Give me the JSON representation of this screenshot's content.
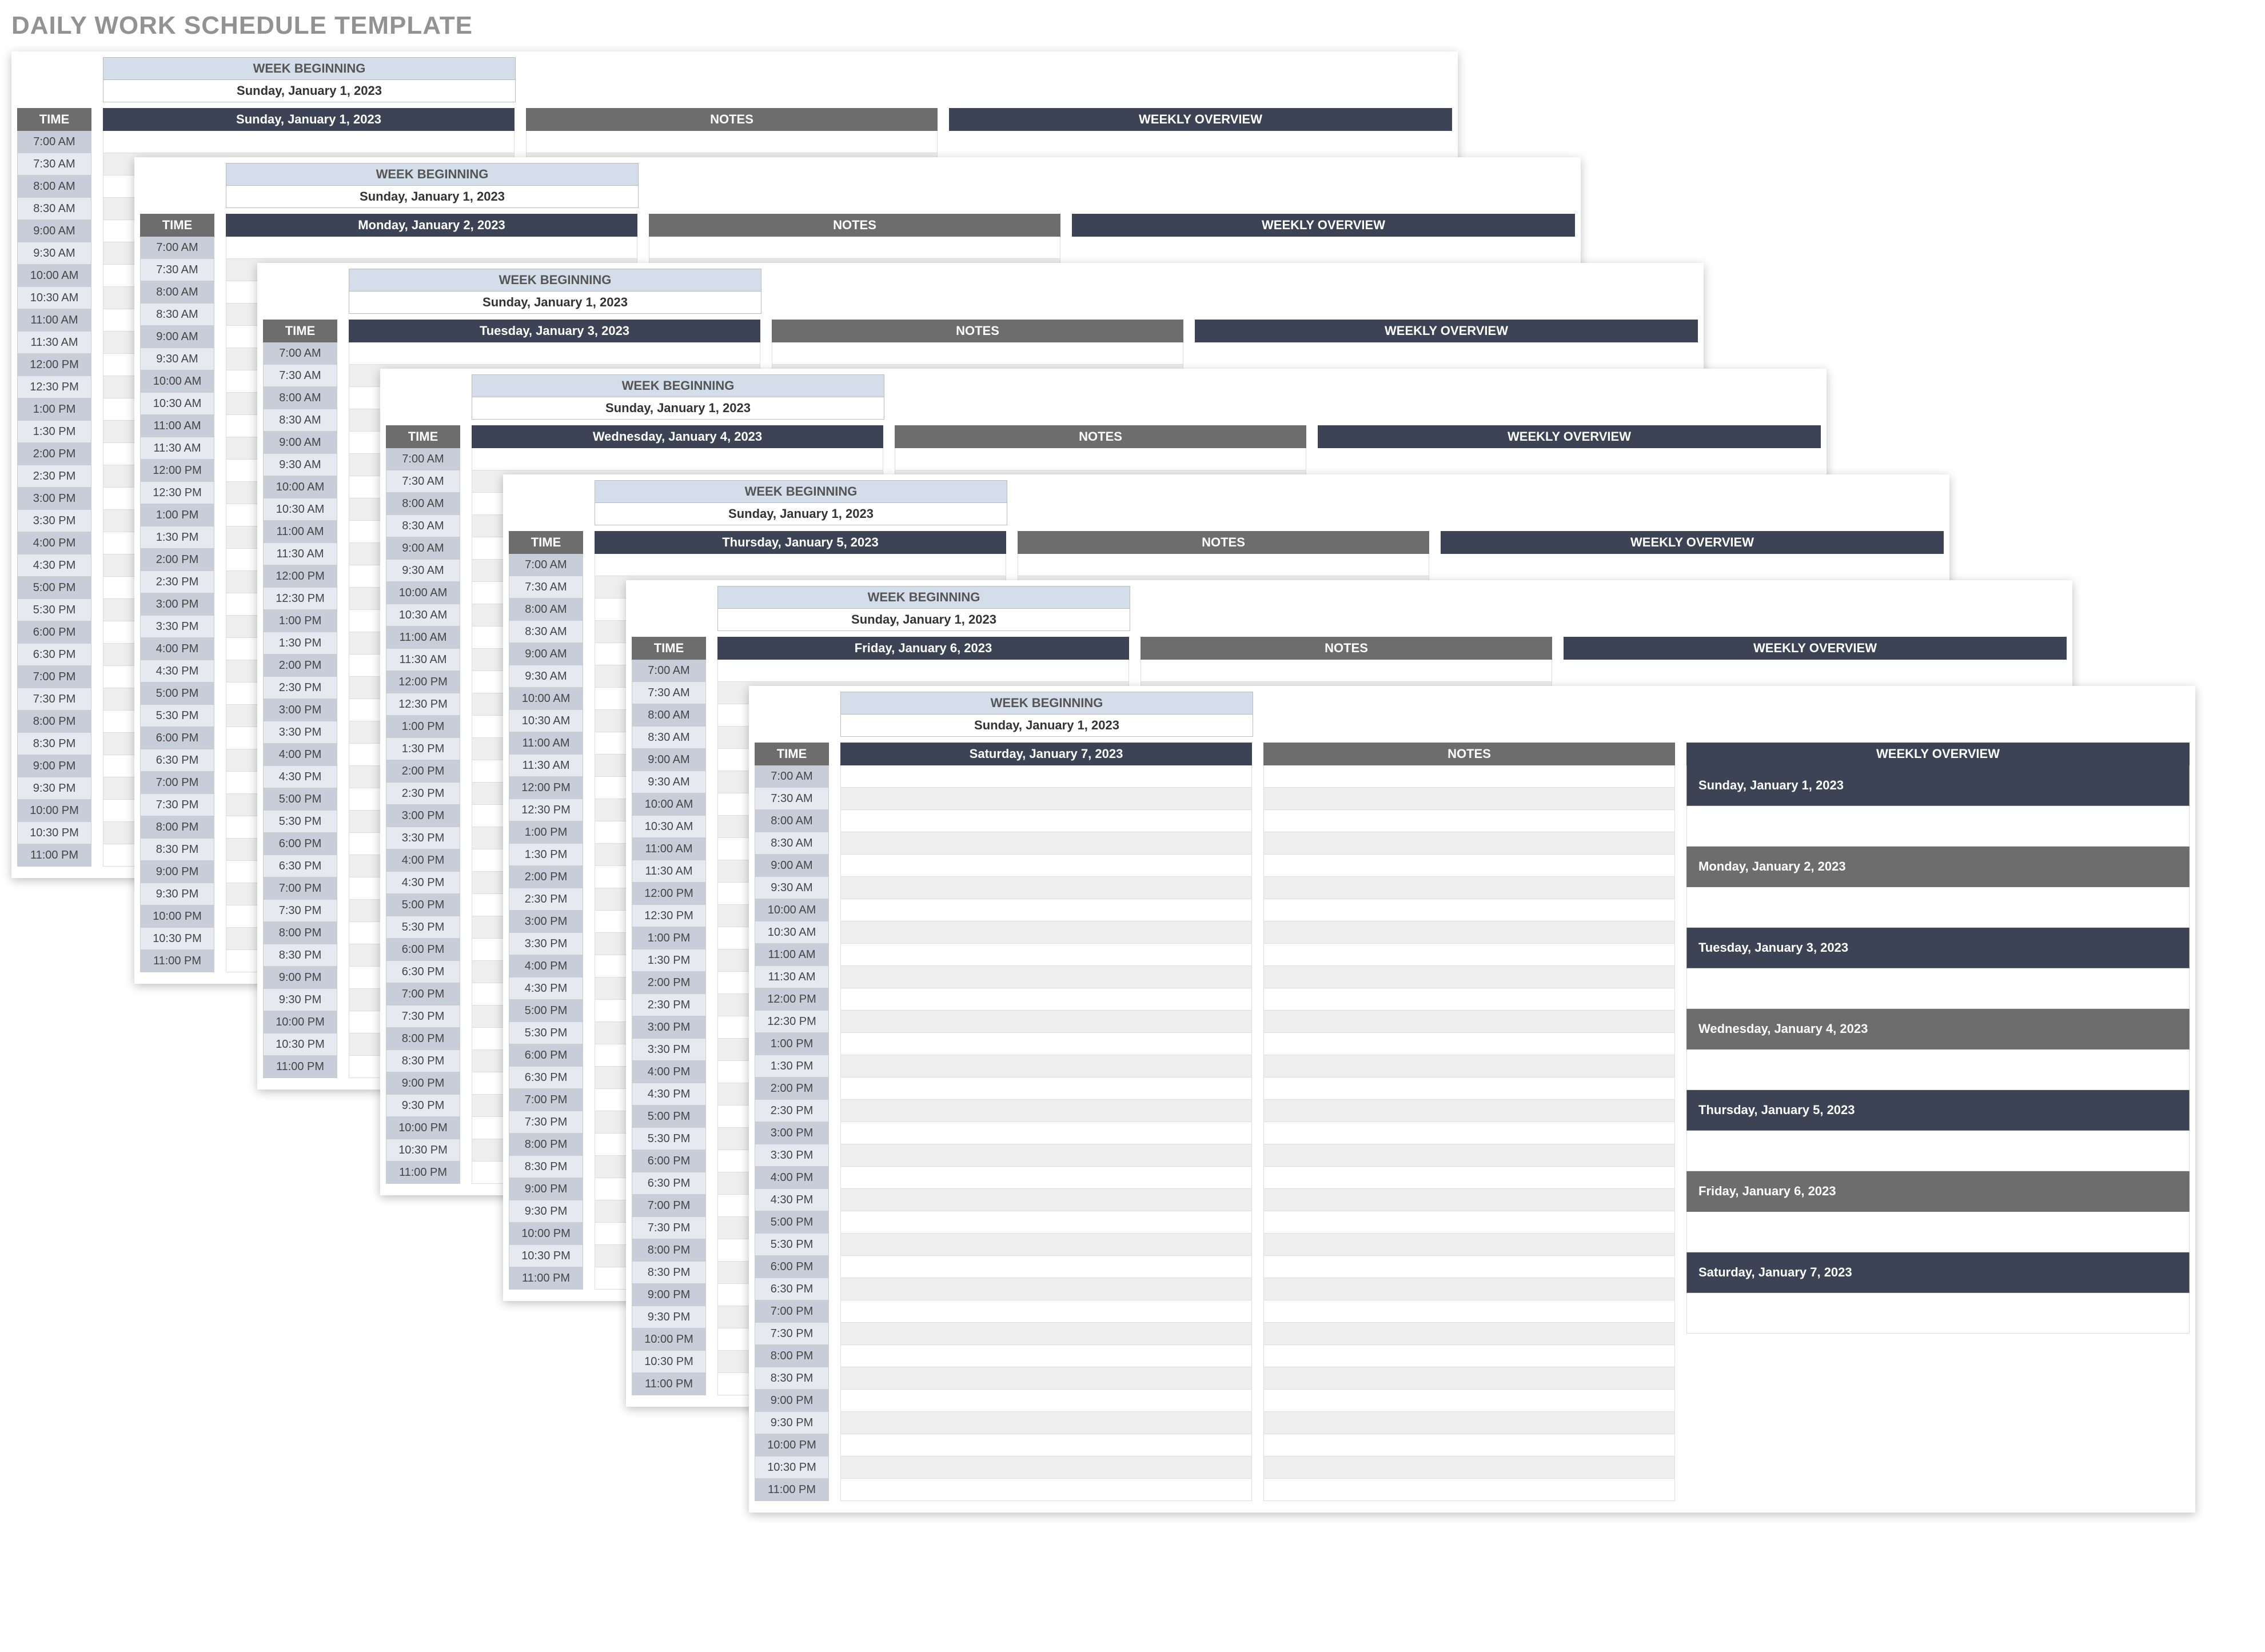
{
  "title": "DAILY WORK SCHEDULE TEMPLATE",
  "week_beginning_label": "WEEK BEGINNING",
  "week_beginning_value": "Sunday, January 1, 2023",
  "columns": {
    "time": "TIME",
    "notes": "NOTES",
    "overview": "WEEKLY OVERVIEW"
  },
  "time_slots": [
    "7:00 AM",
    "7:30 AM",
    "8:00 AM",
    "8:30 AM",
    "9:00 AM",
    "9:30 AM",
    "10:00 AM",
    "10:30 AM",
    "11:00 AM",
    "11:30 AM",
    "12:00 PM",
    "12:30 PM",
    "1:00 PM",
    "1:30 PM",
    "2:00 PM",
    "2:30 PM",
    "3:00 PM",
    "3:30 PM",
    "4:00 PM",
    "4:30 PM",
    "5:00 PM",
    "5:30 PM",
    "6:00 PM",
    "6:30 PM",
    "7:00 PM",
    "7:30 PM",
    "8:00 PM",
    "8:30 PM",
    "9:00 PM",
    "9:30 PM",
    "10:00 PM",
    "10:30 PM",
    "11:00 PM"
  ],
  "days": [
    {
      "label": "Sunday, January 1, 2023"
    },
    {
      "label": "Monday, January 2, 2023"
    },
    {
      "label": "Tuesday, January 3, 2023"
    },
    {
      "label": "Wednesday, January 4, 2023"
    },
    {
      "label": "Thursday, January 5, 2023"
    },
    {
      "label": "Friday, January 6, 2023"
    },
    {
      "label": "Saturday, January 7, 2023"
    }
  ],
  "overview_colors": [
    "#3b4354",
    "#6d6d6d"
  ]
}
